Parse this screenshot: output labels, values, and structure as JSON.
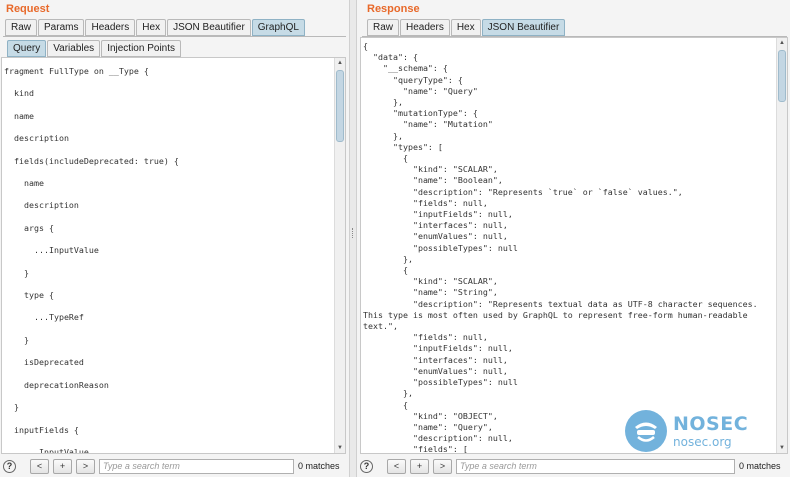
{
  "request": {
    "title": "Request",
    "tabs": [
      "Raw",
      "Params",
      "Headers",
      "Hex",
      "JSON Beautifier",
      "GraphQL"
    ],
    "active_tab": "GraphQL",
    "subtabs": [
      "Query",
      "Variables",
      "Injection Points"
    ],
    "active_subtab": "Query",
    "code_lines": [
      "fragment FullType on __Type {",
      "  kind",
      "  name",
      "  description",
      "  fields(includeDeprecated: true) {",
      "    name",
      "    description",
      "    args {",
      "      ...InputValue",
      "    }",
      "    type {",
      "      ...TypeRef",
      "    }",
      "    isDeprecated",
      "    deprecationReason",
      "  }",
      "  inputFields {",
      "    ...InputValue"
    ],
    "search_placeholder": "Type a search term",
    "matches": "0 matches"
  },
  "response": {
    "title": "Response",
    "tabs": [
      "Raw",
      "Headers",
      "Hex",
      "JSON Beautifier"
    ],
    "active_tab": "JSON Beautifier",
    "code_lines": [
      "{",
      "  \"data\": {",
      "    \"__schema\": {",
      "      \"queryType\": {",
      "        \"name\": \"Query\"",
      "      },",
      "      \"mutationType\": {",
      "        \"name\": \"Mutation\"",
      "      },",
      "      \"types\": [",
      "        {",
      "          \"kind\": \"SCALAR\",",
      "          \"name\": \"Boolean\",",
      "          \"description\": \"Represents `true` or `false` values.\",",
      "          \"fields\": null,",
      "          \"inputFields\": null,",
      "          \"interfaces\": null,",
      "          \"enumValues\": null,",
      "          \"possibleTypes\": null",
      "        },",
      "        {",
      "          \"kind\": \"SCALAR\",",
      "          \"name\": \"String\",",
      "          \"description\": \"Represents textual data as UTF-8 character sequences.",
      "This type is most often used by GraphQL to represent free-form human-readable",
      "text.\",",
      "          \"fields\": null,",
      "          \"inputFields\": null,",
      "          \"interfaces\": null,",
      "          \"enumValues\": null,",
      "          \"possibleTypes\": null",
      "        },",
      "        {",
      "          \"kind\": \"OBJECT\",",
      "          \"name\": \"Query\",",
      "          \"description\": null,",
      "          \"fields\": ["
    ],
    "search_placeholder": "Type a search term",
    "matches": "0 matches"
  },
  "nav": {
    "help": "?",
    "prev": "<",
    "add": "+",
    "next": ">"
  },
  "watermark": {
    "title": "NOSEC",
    "subtitle": "nosec.org"
  },
  "colors": {
    "title_orange": "#e8692a",
    "active_tab": "#c6dbe6",
    "watermark_blue": "#5aa5d6"
  }
}
